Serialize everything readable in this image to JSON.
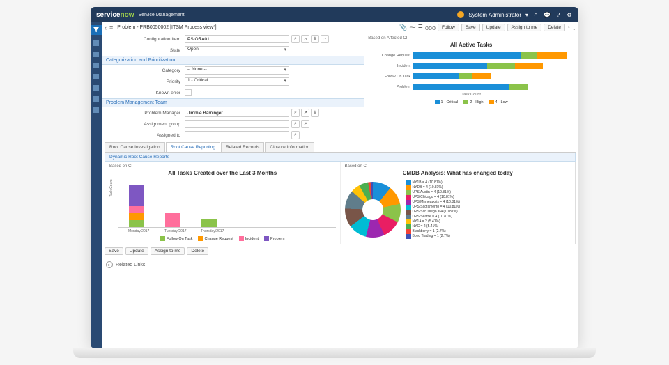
{
  "header": {
    "logo_service": "service",
    "logo_now": "now",
    "logo_sub": "Service Management",
    "user_name": "System Administrator"
  },
  "breadcrumb": {
    "title": "Problem - PRB0050002 [ITSM Process view*]"
  },
  "toolbar": {
    "follow": "Follow",
    "save": "Save",
    "update": "Update",
    "assign": "Assign to me",
    "delete": "Delete"
  },
  "form": {
    "config_item_label": "Configuration Item",
    "config_item_value": "PS ORA01",
    "state_label": "State",
    "state_value": "Open",
    "section_cat": "Categorization and Prioritization",
    "category_label": "Category",
    "category_value": "-- None --",
    "priority_label": "Priority",
    "priority_value": "1 - Critical",
    "known_error_label": "Known error",
    "section_team": "Problem Management Team",
    "pm_label": "Problem Manager",
    "pm_value": "Jimmie Barninger",
    "ag_label": "Assignment group",
    "at_label": "Assigned to"
  },
  "tabs": {
    "t1": "Root Cause Investigation",
    "t2": "Root Cause Reporting",
    "t3": "Related Records",
    "t4": "Closure Information"
  },
  "panel": {
    "title": "Dynamic Root Cause Reports"
  },
  "chart1": {
    "based": "Based on Affected CI",
    "title": "All Active Tasks",
    "axis": "Task Count",
    "cats": [
      "Change Request",
      "Incident",
      "Follow On Task",
      "Problem"
    ],
    "legend": {
      "crit": "1 - Critical",
      "high": "2 - High",
      "low": "4 - Low"
    }
  },
  "chart2": {
    "based": "Based on CI",
    "title": "All Tasks Created over the Last 3 Months",
    "yaxis": "Task Count",
    "labels": [
      "Monday/2017",
      "Tuesday/2017",
      "Thursday/2017"
    ],
    "legend": {
      "fo": "Follow On Task",
      "cr": "Change Request",
      "inc": "Incident",
      "prb": "Problem"
    }
  },
  "chart3": {
    "based": "Based on CI",
    "title": "CMDB Analysis: What has changed today",
    "legend": [
      {
        "c": "#1a8fd8",
        "t": "NY1B = 4 (10.81%)"
      },
      {
        "c": "#ff9800",
        "t": "NYDB = 4 (10.81%)"
      },
      {
        "c": "#8bc34a",
        "t": "UPS Austin = 4 (10.81%)"
      },
      {
        "c": "#e91e63",
        "t": "UPS Chicago = 4 (10.81%)"
      },
      {
        "c": "#9c27b0",
        "t": "UPS Minneapolis = 4 (10.81%)"
      },
      {
        "c": "#00bcd4",
        "t": "UPS Sacramento = 4 (10.81%)"
      },
      {
        "c": "#795548",
        "t": "UPS San Diego = 4 (10.81%)"
      },
      {
        "c": "#607d8b",
        "t": "UPS Seattle = 4 (10.81%)"
      },
      {
        "c": "#ffc107",
        "t": "NY1A = 2 (5.41%)"
      },
      {
        "c": "#4caf50",
        "t": "NYC = 2 (5.41%)"
      },
      {
        "c": "#f44336",
        "t": "Blackberry = 1 (2.7%)"
      },
      {
        "c": "#3f51b5",
        "t": "Bond Trading = 1 (2.7%)"
      }
    ]
  },
  "related": "Related Links",
  "chart_data": [
    {
      "type": "bar",
      "orientation": "horizontal",
      "stacked": true,
      "title": "All Active Tasks",
      "categories": [
        "Change Request",
        "Incident",
        "Follow On Task",
        "Problem"
      ],
      "series": [
        {
          "name": "1 - Critical",
          "values": [
            18,
            12,
            8,
            16
          ]
        },
        {
          "name": "2 - High",
          "values": [
            3,
            5,
            2,
            3
          ]
        },
        {
          "name": "4 - Low",
          "values": [
            5,
            5,
            3,
            0
          ]
        }
      ],
      "xlabel": "Task Count",
      "xlim": [
        0,
        26
      ]
    },
    {
      "type": "bar",
      "orientation": "vertical",
      "stacked": true,
      "title": "All Tasks Created over the Last 3 Months",
      "categories": [
        "Monday/2017",
        "Tuesday/2017",
        "Thursday/2017"
      ],
      "series": [
        {
          "name": "Follow On Task",
          "values": [
            1,
            0,
            1
          ]
        },
        {
          "name": "Change Request",
          "values": [
            1,
            0,
            0
          ]
        },
        {
          "name": "Incident",
          "values": [
            1,
            2,
            0
          ]
        },
        {
          "name": "Problem",
          "values": [
            3,
            0,
            0
          ]
        }
      ],
      "ylabel": "Task Count",
      "ylim": [
        0,
        6
      ]
    },
    {
      "type": "pie",
      "subtype": "donut",
      "title": "CMDB Analysis: What has changed today",
      "categories": [
        "NY1B",
        "NYDB",
        "UPS Austin",
        "UPS Chicago",
        "UPS Minneapolis",
        "UPS Sacramento",
        "UPS San Diego",
        "UPS Seattle",
        "NY1A",
        "NYC",
        "Blackberry",
        "Bond Trading"
      ],
      "values": [
        4,
        4,
        4,
        4,
        4,
        4,
        4,
        4,
        2,
        2,
        1,
        1
      ],
      "percentages": [
        10.81,
        10.81,
        10.81,
        10.81,
        10.81,
        10.81,
        10.81,
        10.81,
        5.41,
        5.41,
        2.7,
        2.7
      ]
    }
  ]
}
